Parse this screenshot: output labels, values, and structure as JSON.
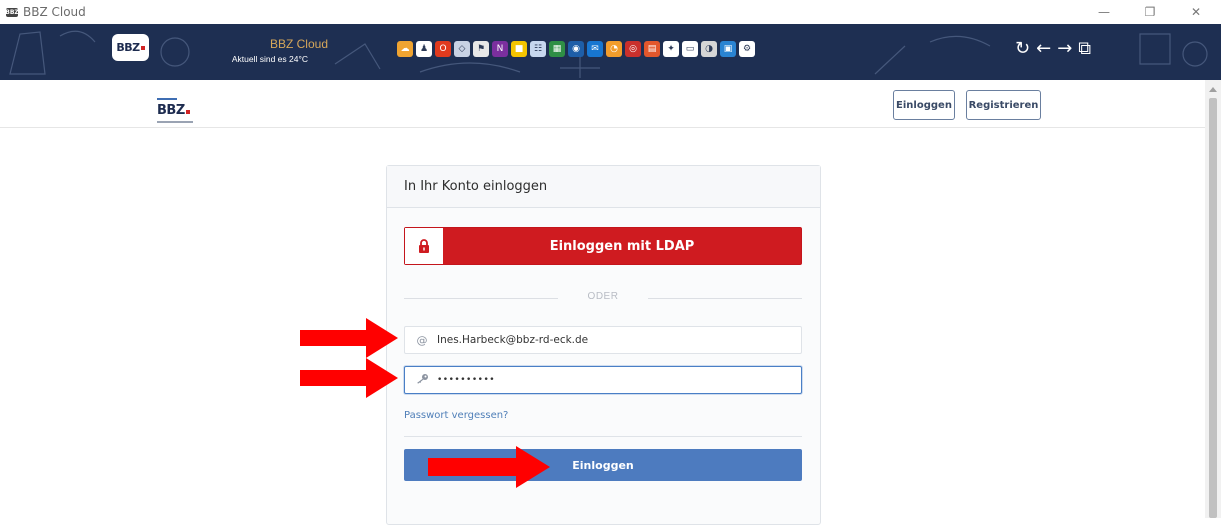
{
  "window": {
    "title": "BBZ Cloud",
    "app_icon_text": "BBZ",
    "controls": [
      "—",
      "❐",
      "✕"
    ]
  },
  "toolbar": {
    "logo_text": "BBZ",
    "cloud_title": "BBZ Cloud",
    "weather": "Aktuell sind es 24°C",
    "nav": [
      "↻",
      "←",
      "→",
      "⧉"
    ],
    "app_icons": [
      {
        "name": "cloud-icon",
        "color": "#f0a431",
        "glyph": "☁"
      },
      {
        "name": "meeting-icon",
        "color": "#ffffff",
        "glyph": "♟"
      },
      {
        "name": "office-icon",
        "color": "#e03a1e",
        "glyph": "O"
      },
      {
        "name": "shield-icon",
        "color": "#c8d2e4",
        "glyph": "◇"
      },
      {
        "name": "pin-icon",
        "color": "#e8e8e8",
        "glyph": "⚑"
      },
      {
        "name": "onenote-icon",
        "color": "#7b2f9e",
        "glyph": "N"
      },
      {
        "name": "sticky-note-icon",
        "color": "#f4c400",
        "glyph": "■"
      },
      {
        "name": "sitemap-icon",
        "color": "#c7d7ee",
        "glyph": "☷"
      },
      {
        "name": "chalkboard-icon",
        "color": "#2f8f45",
        "glyph": "▦"
      },
      {
        "name": "record-icon",
        "color": "#1e5ea8",
        "glyph": "◉"
      },
      {
        "name": "outlook-icon",
        "color": "#1776d1",
        "glyph": "✉"
      },
      {
        "name": "clock-icon",
        "color": "#f29d2c",
        "glyph": "◔"
      },
      {
        "name": "target-icon",
        "color": "#c9302c",
        "glyph": "◎"
      },
      {
        "name": "book-icon",
        "color": "#e2572c",
        "glyph": "▤"
      },
      {
        "name": "link-icon",
        "color": "#ffffff",
        "glyph": "✦"
      },
      {
        "name": "reader-icon",
        "color": "#ffffff",
        "glyph": "▭"
      },
      {
        "name": "gauge-icon",
        "color": "#d6d6d6",
        "glyph": "◑"
      },
      {
        "name": "form-icon",
        "color": "#2a84d2",
        "glyph": "▣"
      },
      {
        "name": "gear-icon",
        "color": "#ffffff",
        "glyph": "⚙"
      }
    ]
  },
  "header": {
    "logo_text": "BBZ",
    "login_label": "Einloggen",
    "register_label": "Registrieren"
  },
  "login": {
    "title": "In Ihr Konto einloggen",
    "ldap_label": "Einloggen mit LDAP",
    "divider": "ODER",
    "email_value": "Ines.Harbeck@bbz-rd-eck.de",
    "password_mask": "••••••••••",
    "forgot_label": "Passwort vergessen?",
    "submit_label": "Einloggen"
  },
  "colors": {
    "toolbar_bg": "#1e2f52",
    "ldap_red": "#cf1b20",
    "primary_blue": "#4d7bbf",
    "annotation_arrow": "#ff0000"
  }
}
